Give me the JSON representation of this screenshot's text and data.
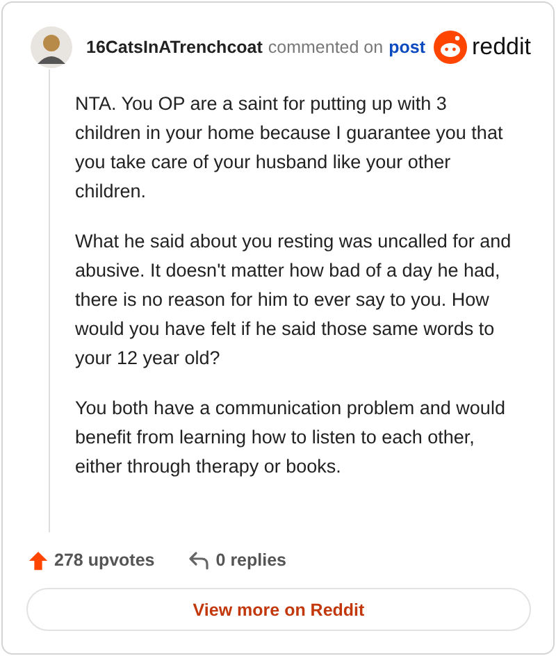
{
  "comment": {
    "author": "16CatsInATrenchcoat",
    "action": "commented on",
    "link": "post"
  },
  "brand": {
    "name": "reddit"
  },
  "paragraphs": [
    "NTA. You OP are a saint for putting up with 3 children in your home because I guarantee you that you take care of your husband like your other children.",
    "What he said about you resting was uncalled for and abusive. It doesn't matter how bad of a day he had, there is no reason for him to ever say to you. How would you have felt if he said those same words to your 12 year old?",
    "You both have a communication problem and would benefit from learning how to listen to each other, either through therapy or books."
  ],
  "footer": {
    "upvotes": "278 upvotes",
    "replies": "0 replies"
  },
  "button": "View more on Reddit"
}
